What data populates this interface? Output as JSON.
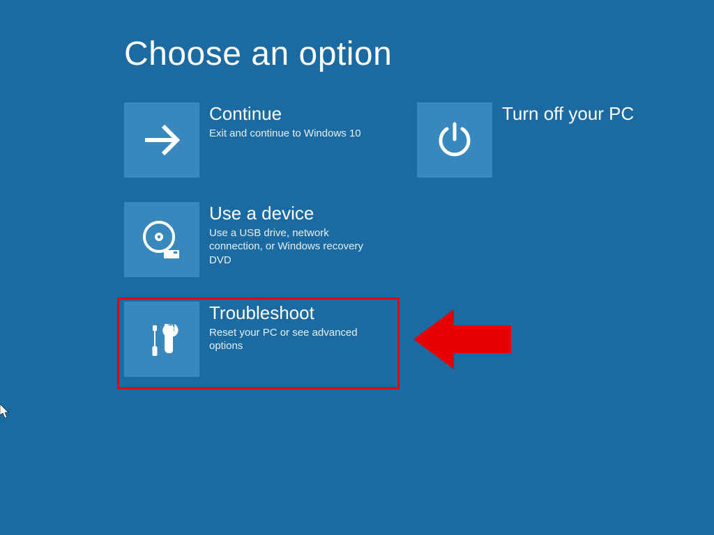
{
  "title": "Choose an option",
  "options": {
    "continue": {
      "title": "Continue",
      "desc": "Exit and continue to Windows 10"
    },
    "turnoff": {
      "title": "Turn off your PC"
    },
    "device": {
      "title": "Use a device",
      "desc": "Use a USB drive, network connection, or Windows recovery DVD"
    },
    "troubleshoot": {
      "title": "Troubleshoot",
      "desc": "Reset your PC or see advanced options"
    }
  },
  "annotation": {
    "highlight_color": "#e60000",
    "arrow_color": "#e60000"
  }
}
